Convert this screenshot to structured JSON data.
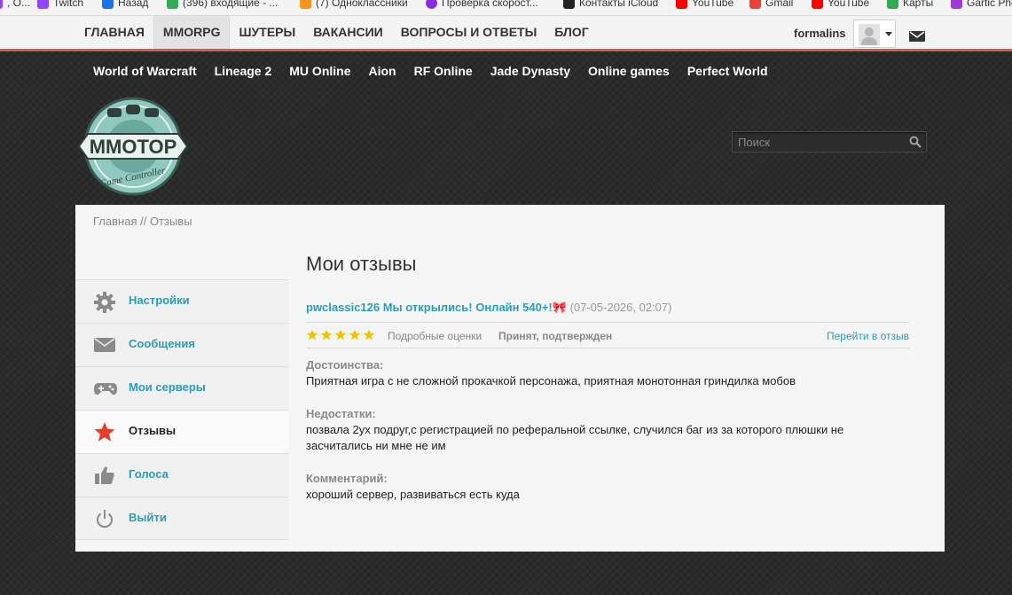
{
  "bookmarks": [
    {
      "label": "",
      "color": "#9146ff"
    },
    {
      "label": "Twitch",
      "color": "#9146ff"
    },
    {
      "label": "Назад",
      "color": "#1a73e8"
    },
    {
      "label": "(396) входящие - ...",
      "color": "#34a853"
    },
    {
      "label": "(7) Одноклассники",
      "color": "#f7931e"
    },
    {
      "label": "Проверка скорост...",
      "color": "#8a2be2"
    },
    {
      "label": "Контакты iCloud",
      "color": "#222222"
    },
    {
      "label": "YouTube",
      "color": "#ff0000"
    },
    {
      "label": "Gmail",
      "color": "#ea4335"
    },
    {
      "label": "YouTube",
      "color": "#ff0000"
    },
    {
      "label": "Карты",
      "color": "#34a853"
    },
    {
      "label": "Gartic Pho",
      "color": "#9b3bd6"
    }
  ],
  "topnav": {
    "items": [
      "ГЛАВНАЯ",
      "MMORPG",
      "ШУТЕРЫ",
      "ВАКАНСИИ",
      "ВОПРОСЫ И ОТВЕТЫ",
      "БЛОГ"
    ],
    "active": "MMORPG",
    "username": "formalins",
    "accent": "#d55c45"
  },
  "subnav": [
    "World of Warcraft",
    "Lineage 2",
    "MU Online",
    "Aion",
    "RF Online",
    "Jade Dynasty",
    "Online games",
    "Perfect World"
  ],
  "logo": {
    "text": "MMOTOP",
    "tagline": "Game Controller"
  },
  "search": {
    "placeholder": "Поиск",
    "value": ""
  },
  "breadcrumb": {
    "home": "Главная",
    "separator": " // ",
    "current": "Отзывы"
  },
  "sidebar": [
    {
      "label": "Настройки",
      "icon": "gear-icon"
    },
    {
      "label": "Сообщения",
      "icon": "envelope-icon"
    },
    {
      "label": "Мои серверы",
      "icon": "gamepad-icon"
    },
    {
      "label": "Отзывы",
      "icon": "star-icon",
      "active": true
    },
    {
      "label": "Голоса",
      "icon": "thumbs-up-icon"
    },
    {
      "label": "Выйти",
      "icon": "power-icon"
    }
  ],
  "main": {
    "title": "Мои отзывы",
    "review": {
      "title": "pwclassic126 Мы открылись! Онлайн 540+!",
      "emoji": "🎀",
      "date": "(07-05-2026, 02:07)",
      "rating": 5,
      "details_link": "Подробные оценки",
      "status": "Принят, подтвержден",
      "goto_link": "Перейти в отзыв",
      "pros_label": "Достоинства:",
      "pros": "Приятная игра с не сложной прокачкой персонажа, приятная монотонная гриндилка мобов",
      "cons_label": "Недостатки:",
      "cons_line1": "позвала 2ух подруг,с регистрацией по реферальной ссылке, случился баг из за которого плюшки не",
      "cons_line2": "засчитались ни мне не им",
      "comment_label": "Комментарий:",
      "comment": "хороший сервер, развиваться есть куда"
    }
  }
}
